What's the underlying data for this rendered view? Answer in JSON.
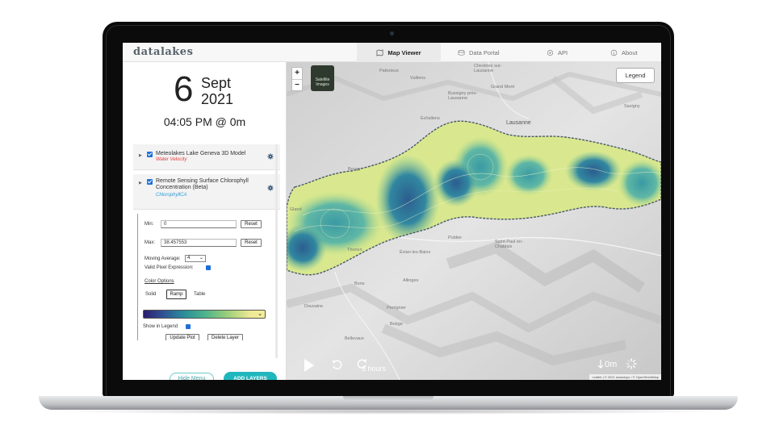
{
  "app": {
    "logo": "datalakes"
  },
  "nav": [
    {
      "label": "Map Viewer",
      "icon": "map-viewer-icon",
      "active": true
    },
    {
      "label": "Data Portal",
      "icon": "data-portal-icon",
      "active": false
    },
    {
      "label": "API",
      "icon": "api-icon",
      "active": false
    },
    {
      "label": "About",
      "icon": "about-icon",
      "active": false
    }
  ],
  "date": {
    "day": "6",
    "month": "Sept",
    "year": "2021",
    "time": "04:05 PM @ 0m"
  },
  "layers": [
    {
      "title": "Meteolakes Lake Geneva 3D Model",
      "subtitle": "Water Velocity",
      "subtitle_color": "#e33b3b",
      "checked": true
    },
    {
      "title": "Remote Sensing Surface Chlorophyll Concentration (Beta)",
      "subtitle": "ChlorophyllCA",
      "subtitle_color": "#2e9bd6",
      "checked": true
    }
  ],
  "settings": {
    "min_label": "Min:",
    "min_value": "0",
    "max_label": "Max:",
    "max_value": "38.457553",
    "reset_label": "Reset",
    "moving_average_label": "Moving Average:",
    "moving_average_value": "4",
    "valid_pixel_label": "Valid Pixel Expression:",
    "color_options_label": "Color Options",
    "color_tabs": [
      "Solid",
      "Ramp",
      "Table"
    ],
    "color_tab_selected": "Ramp",
    "show_in_legend_label": "Show in Legend",
    "update_plot_label": "Update Plot",
    "delete_layer_label": "Delete Layer"
  },
  "sidebar_actions": {
    "hide_menu": "Hide Menu",
    "add_layers": "ADD LAYERS"
  },
  "map": {
    "zoom_in": "+",
    "zoom_out": "−",
    "basemap_label": "Satellite Images",
    "legend_button": "Legend",
    "places": [
      "Chexbres sur-Lausanne",
      "Palezieux",
      "Vulliens",
      "Grand Mont",
      "Bussigny près-Lausanne",
      "Lausanne",
      "Echallens",
      "Savigny",
      "Bougy",
      "Gland",
      "Évian-les-Bains",
      "Publier",
      "Saint-Paul en-Chablais",
      "Thonon",
      "Allinges",
      "Bons",
      "Douvaine",
      "Perrignier",
      "Boëge",
      "Bellevaux"
    ],
    "time_step": "3 hours",
    "depth": "0m",
    "attribution": "Leaflet | © 2021 swisstopo / © OpenStreetMap"
  },
  "colors": {
    "accent": "#1fb7bd",
    "checkbox": "#1f6fd8"
  }
}
